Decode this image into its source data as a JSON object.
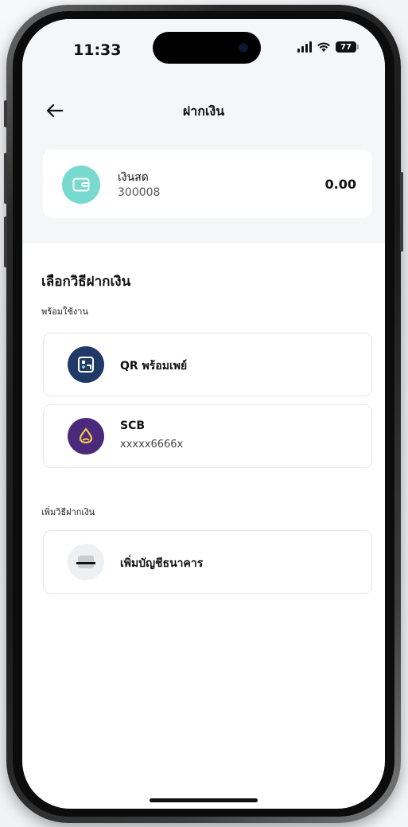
{
  "status_bar": {
    "time": "11:33",
    "battery": "77"
  },
  "header": {
    "title": "ฝากเงิน",
    "back_icon": "arrow-left-icon"
  },
  "account": {
    "icon": "wallet-icon",
    "icon_color": "#78d9cf",
    "name": "เงินสด",
    "number": "300008",
    "balance": "0.00"
  },
  "deposit": {
    "section_title": "เลือกวิธีฝากเงิน",
    "ready_label": "พร้อมใช้งาน",
    "methods": [
      {
        "icon": "qr-icon",
        "icon_color": "#1f3a66",
        "label": "QR พร้อมเพย์",
        "sub": ""
      },
      {
        "icon": "scb-icon",
        "icon_color": "#4b2a7b",
        "label": "SCB",
        "sub": "xxxxx6666x"
      }
    ],
    "add_label": "เพิ่มวิธีฝากเงิน",
    "add_method": {
      "icon": "bank-card-icon",
      "icon_color": "#eef0f3",
      "label": "เพิ่มบัญชีธนาคาร"
    }
  }
}
